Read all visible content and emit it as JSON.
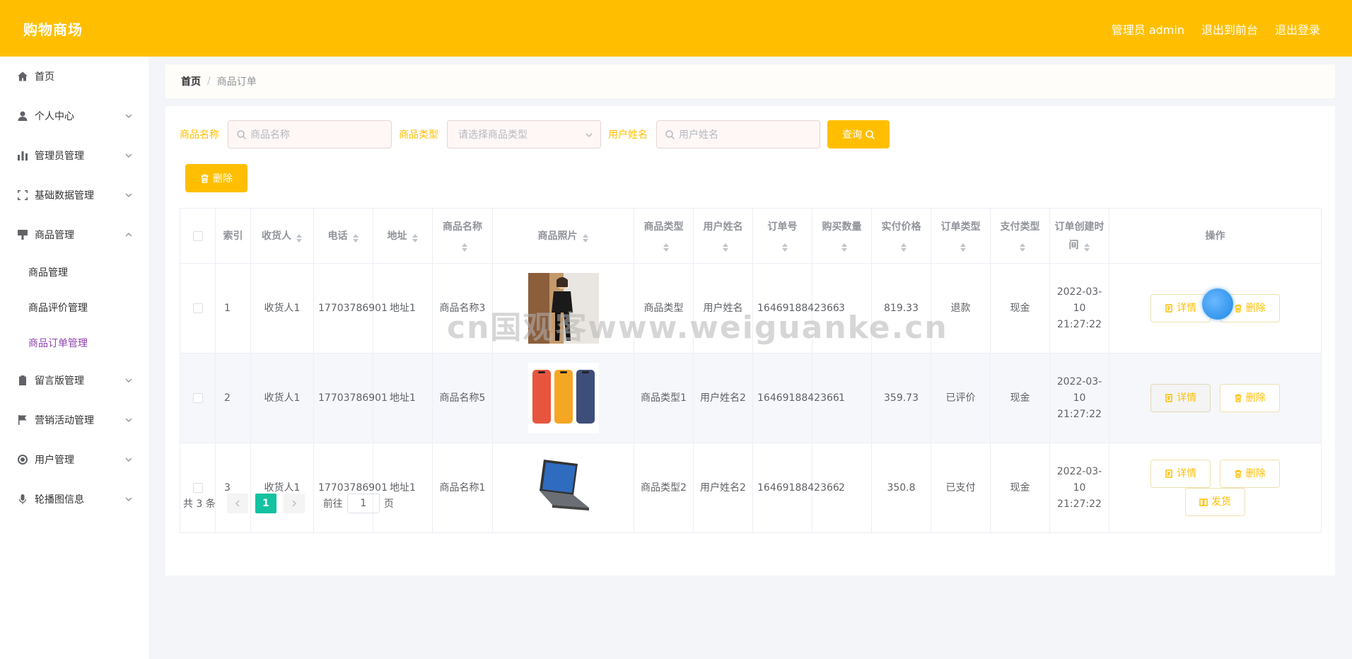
{
  "header": {
    "brand": "购物商场",
    "admin_label": "管理员 admin",
    "to_front": "退出到前台",
    "logout": "退出登录"
  },
  "sidebar": {
    "items": [
      {
        "label": "首页",
        "icon": "home-icon"
      },
      {
        "label": "个人中心",
        "icon": "user-icon"
      },
      {
        "label": "管理员管理",
        "icon": "chart-icon"
      },
      {
        "label": "基础数据管理",
        "icon": "frame-icon"
      },
      {
        "label": "商品管理",
        "icon": "brush-icon"
      },
      {
        "label": "留言版管理",
        "icon": "clipboard-icon"
      },
      {
        "label": "营销活动管理",
        "icon": "flag-icon"
      },
      {
        "label": "用户管理",
        "icon": "circle-icon"
      },
      {
        "label": "轮播图信息",
        "icon": "mic-icon"
      }
    ],
    "sub_items": [
      {
        "label": "商品管理"
      },
      {
        "label": "商品评价管理"
      },
      {
        "label": "商品订单管理",
        "active": true
      }
    ],
    "active_color": "#8e44ad"
  },
  "breadcrumb": {
    "home": "首页",
    "sep": "/",
    "current": "商品订单"
  },
  "search": {
    "name_label": "商品名称",
    "name_placeholder": "商品名称",
    "type_label": "商品类型",
    "type_placeholder": "请选择商品类型",
    "user_label": "用户姓名",
    "user_placeholder": "用户姓名",
    "query_label": "查询",
    "delete_label": "删除"
  },
  "table": {
    "headers": [
      "索引",
      "收货人",
      "电话",
      "地址",
      "商品名称",
      "商品照片",
      "商品类型",
      "用户姓名",
      "订单号",
      "购买数量",
      "实付价格",
      "订单类型",
      "支付类型",
      "订单创建时间",
      "操作"
    ],
    "rows": [
      {
        "index": "1",
        "receiver": "收货人1",
        "phone": "17703786901",
        "address": "地址1",
        "goods_name": "商品名称3",
        "photo": "woman-in-suit-photo",
        "goods_type": "商品类型",
        "user_name": "用户姓名",
        "order_no": "1646918842366",
        "qty": "3",
        "price": "819.33",
        "order_type": "退款",
        "pay_type": "现金",
        "created": "2022-03-10 21:27:22",
        "ops": [
          "详情",
          "删除"
        ]
      },
      {
        "index": "2",
        "receiver": "收货人1",
        "phone": "17703786901",
        "address": "地址1",
        "goods_name": "商品名称5",
        "photo": "phones-photo",
        "goods_type": "商品类型1",
        "user_name": "用户姓名2",
        "order_no": "1646918842366",
        "qty": "1",
        "price": "359.73",
        "order_type": "已评价",
        "pay_type": "现金",
        "created": "2022-03-10 21:27:22",
        "ops": [
          "详情",
          "删除"
        ]
      },
      {
        "index": "3",
        "receiver": "收货人1",
        "phone": "17703786901",
        "address": "地址1",
        "goods_name": "商品名称1",
        "photo": "laptop-photo",
        "goods_type": "商品类型2",
        "user_name": "用户姓名2",
        "order_no": "1646918842366",
        "qty": "2",
        "price": "350.8",
        "order_type": "已支付",
        "pay_type": "现金",
        "created": "2022-03-10 21:27:22",
        "ops": [
          "详情",
          "删除",
          "发货"
        ]
      }
    ]
  },
  "pager": {
    "total": "共 3 条",
    "current": "1",
    "goto_prefix": "前往",
    "goto_value": "1",
    "goto_suffix": "页"
  },
  "watermark": "cn国观客www.weiguanke.cn",
  "colors": {
    "accent": "#ffbf00",
    "pager_active": "#13c2a0"
  }
}
